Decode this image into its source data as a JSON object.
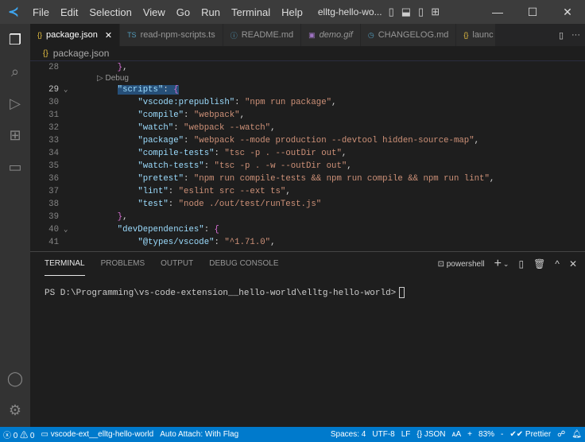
{
  "titlebar": {
    "menus": [
      "File",
      "Edit",
      "Selection",
      "View",
      "Go",
      "Run",
      "Terminal",
      "Help"
    ],
    "title": "elltg-hello-wo..."
  },
  "tabs": [
    {
      "label": "package.json",
      "icon": "{}",
      "color": "#e8c141",
      "active": true
    },
    {
      "label": "read-npm-scripts.ts",
      "icon": "TS",
      "color": "#519aba"
    },
    {
      "label": "README.md",
      "icon": "ⓘ",
      "color": "#519aba"
    },
    {
      "label": "demo.gif",
      "icon": "▣",
      "color": "#a074c4"
    },
    {
      "label": "CHANGELOG.md",
      "icon": "◷",
      "color": "#519aba"
    },
    {
      "label": "launc",
      "icon": "{}",
      "color": "#e8c141"
    }
  ],
  "breadcrumb": {
    "icon": "{}",
    "file": "package.json"
  },
  "editor": {
    "codelens": "▷ Debug",
    "lines": [
      {
        "n": "28",
        "parts": [
          [
            "p",
            "    "
          ],
          [
            "b1",
            "}"
          ],
          [
            "p",
            ","
          ]
        ]
      },
      {
        "n": "29",
        "fold": true,
        "parts": [
          [
            "p",
            "    "
          ],
          [
            "k sel",
            "\"scripts\""
          ],
          [
            "p sel",
            ": "
          ],
          [
            "b1 sel",
            "{"
          ]
        ]
      },
      {
        "n": "30",
        "parts": [
          [
            "p",
            "        "
          ],
          [
            "k",
            "\"vscode:prepublish\""
          ],
          [
            "p",
            ": "
          ],
          [
            "s",
            "\"npm run package\""
          ],
          [
            "p",
            ","
          ]
        ]
      },
      {
        "n": "31",
        "parts": [
          [
            "p",
            "        "
          ],
          [
            "k",
            "\"compile\""
          ],
          [
            "p",
            ": "
          ],
          [
            "s",
            "\"webpack\""
          ],
          [
            "p",
            ","
          ]
        ]
      },
      {
        "n": "32",
        "parts": [
          [
            "p",
            "        "
          ],
          [
            "k",
            "\"watch\""
          ],
          [
            "p",
            ": "
          ],
          [
            "s",
            "\"webpack --watch\""
          ],
          [
            "p",
            ","
          ]
        ]
      },
      {
        "n": "33",
        "parts": [
          [
            "p",
            "        "
          ],
          [
            "k",
            "\"package\""
          ],
          [
            "p",
            ": "
          ],
          [
            "s",
            "\"webpack --mode production --devtool hidden-source-map\""
          ],
          [
            "p",
            ","
          ]
        ]
      },
      {
        "n": "34",
        "parts": [
          [
            "p",
            "        "
          ],
          [
            "k",
            "\"compile-tests\""
          ],
          [
            "p",
            ": "
          ],
          [
            "s",
            "\"tsc -p . --outDir out\""
          ],
          [
            "p",
            ","
          ]
        ]
      },
      {
        "n": "35",
        "parts": [
          [
            "p",
            "        "
          ],
          [
            "k",
            "\"watch-tests\""
          ],
          [
            "p",
            ": "
          ],
          [
            "s",
            "\"tsc -p . -w --outDir out\""
          ],
          [
            "p",
            ","
          ]
        ]
      },
      {
        "n": "36",
        "parts": [
          [
            "p",
            "        "
          ],
          [
            "k",
            "\"pretest\""
          ],
          [
            "p",
            ": "
          ],
          [
            "s",
            "\"npm run compile-tests && npm run compile && npm run lint\""
          ],
          [
            "p",
            ","
          ]
        ]
      },
      {
        "n": "37",
        "parts": [
          [
            "p",
            "        "
          ],
          [
            "k",
            "\"lint\""
          ],
          [
            "p",
            ": "
          ],
          [
            "s",
            "\"eslint src --ext ts\""
          ],
          [
            "p",
            ","
          ]
        ]
      },
      {
        "n": "38",
        "parts": [
          [
            "p",
            "        "
          ],
          [
            "k",
            "\"test\""
          ],
          [
            "p",
            ": "
          ],
          [
            "s",
            "\"node ./out/test/runTest.js\""
          ]
        ]
      },
      {
        "n": "39",
        "parts": [
          [
            "p",
            "    "
          ],
          [
            "b1",
            "}"
          ],
          [
            "p",
            ","
          ]
        ]
      },
      {
        "n": "40",
        "fold": true,
        "parts": [
          [
            "p",
            "    "
          ],
          [
            "k",
            "\"devDependencies\""
          ],
          [
            "p",
            ": "
          ],
          [
            "b1",
            "{"
          ]
        ]
      },
      {
        "n": "41",
        "parts": [
          [
            "p",
            "        "
          ],
          [
            "k",
            "\"@types/vscode\""
          ],
          [
            "p",
            ": "
          ],
          [
            "s",
            "\"^1.71.0\""
          ],
          [
            "p",
            ","
          ]
        ]
      }
    ]
  },
  "panel": {
    "tabs": [
      "TERMINAL",
      "PROBLEMS",
      "OUTPUT",
      "DEBUG CONSOLE"
    ],
    "shell": "powershell",
    "prompt": "PS D:\\Programming\\vs-code-extension__hello-world\\elltg-hello-world>"
  },
  "status": {
    "errors": "0",
    "warnings": "0",
    "folder": "vscode-ext__elltg-hello-world",
    "auto_attach": "Auto Attach: With Flag",
    "spaces": "Spaces: 4",
    "encoding": "UTF-8",
    "eol": "LF",
    "language": "JSON",
    "font": "ᴀA",
    "zoom_in": "+",
    "zoom": "83%",
    "zoom_out": "-",
    "prettier": "Prettier"
  }
}
